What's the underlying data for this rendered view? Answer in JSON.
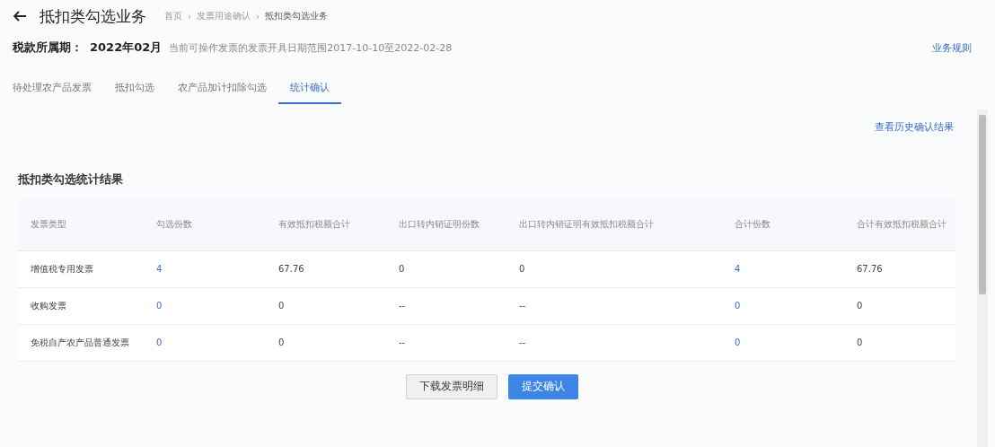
{
  "header": {
    "title": "抵扣类勾选业务",
    "breadcrumb": [
      "首页",
      "发票用途确认",
      "抵扣类勾选业务"
    ],
    "separator": "›"
  },
  "period": {
    "label": "税款所属期：",
    "value": "2022年02月",
    "note": "当前可操作发票的发票开具日期范围2017-10-10至2022-02-28",
    "link": "业务规则"
  },
  "tabs": [
    {
      "label": "待处理农产品发票",
      "selected": false
    },
    {
      "label": "抵扣勾选",
      "selected": false
    },
    {
      "label": "农产品加计扣除勾选",
      "selected": false
    },
    {
      "label": "统计确认",
      "selected": true
    }
  ],
  "history_link": "查看历史确认结果",
  "section_title": "抵扣类勾选统计结果",
  "table": {
    "columns": [
      "发票类型",
      "勾选份数",
      "有效抵扣税额合计",
      "出口转内销证明份数",
      "出口转内销证明有效抵扣税额合计",
      "合计份数",
      "合计有效抵扣税额合计"
    ],
    "rows": [
      {
        "cells": [
          "增值税专用发票",
          "4",
          "67.76",
          "0",
          "0",
          "4",
          "67.76"
        ]
      },
      {
        "cells": [
          "收购发票",
          "0",
          "0",
          "--",
          "--",
          "0",
          "0"
        ]
      },
      {
        "cells": [
          "免税自产农产品普通发票",
          "0",
          "0",
          "--",
          "--",
          "0",
          "0"
        ]
      }
    ]
  },
  "buttons": [
    {
      "label": "下载发票明细",
      "kind": "secondary"
    },
    {
      "label": "提交确认",
      "kind": "primary"
    }
  ]
}
